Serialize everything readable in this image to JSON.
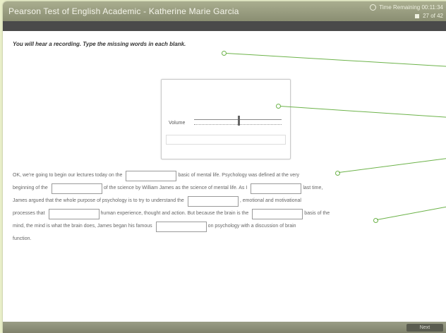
{
  "window": {
    "title": "Pearson Test of English Academic - Katherine Marie Garcia",
    "timer": "Time Remaining 00:11:34",
    "counter": "27 of 42"
  },
  "instruction": "You will hear a recording. Type the missing words in each blank.",
  "audio": {
    "volume_label": "Volume"
  },
  "passage": {
    "lines": [
      [
        "OK, we're going to begin our lectures today on the",
        "#gap",
        "basic of mental life. Psychology was defined at the very"
      ],
      [
        "beginning of the",
        "#gap",
        "of the science by William James as the science of mental life. As I",
        "#gap",
        "last time,"
      ],
      [
        "James argued that the whole purpose of psychology is to try to understand the",
        "#gap",
        ", emotional and motivational"
      ],
      [
        "processes that",
        "#gap",
        "human experience, thought and action. But because the brain is the",
        "#gap",
        "basis of the"
      ],
      [
        "mind, the mind is what the brain does, James began his famous",
        "#gap",
        "on psychology with a discussion of brain"
      ],
      [
        "function."
      ]
    ]
  },
  "footer": {
    "next_label": "Next"
  },
  "colors": {
    "accent": "#6db34a",
    "titlebar": "#9a9e82",
    "background": "#e9efc9"
  }
}
